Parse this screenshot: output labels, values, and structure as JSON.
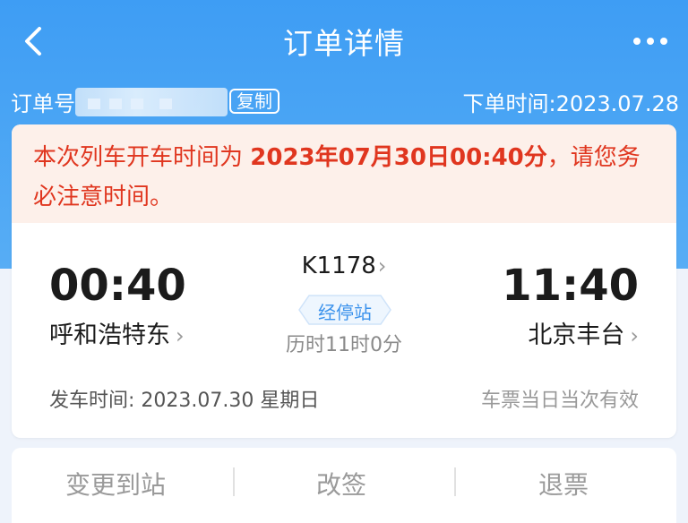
{
  "header": {
    "title": "订单详情",
    "back_icon": "chevron-left-icon",
    "more_icon": "more-dots-icon"
  },
  "order": {
    "number_label": "订单号",
    "copy_label": "复制",
    "time_text": "下单时间:2023.07.28"
  },
  "notice": {
    "prefix": "本次列车开车时间为 ",
    "highlight": "2023年07月30日00:40分",
    "suffix": "，请您务必注意时间。"
  },
  "trip": {
    "departure_time": "00:40",
    "departure_station": "呼和浩特东",
    "train_number": "K1178",
    "stops_label": "经停站",
    "duration": "历时11时0分",
    "arrival_time": "11:40",
    "arrival_station": "北京丰台",
    "depart_date_text": "发车时间:  2023.07.30 星期日",
    "validity": "车票当日当次有效"
  },
  "actions": [
    {
      "label": "变更到站"
    },
    {
      "label": "改签"
    },
    {
      "label": "退票"
    }
  ],
  "colors": {
    "header_blue": "#3e9df4",
    "alert_red": "#e0361f",
    "badge_blue": "#3b92ec"
  }
}
